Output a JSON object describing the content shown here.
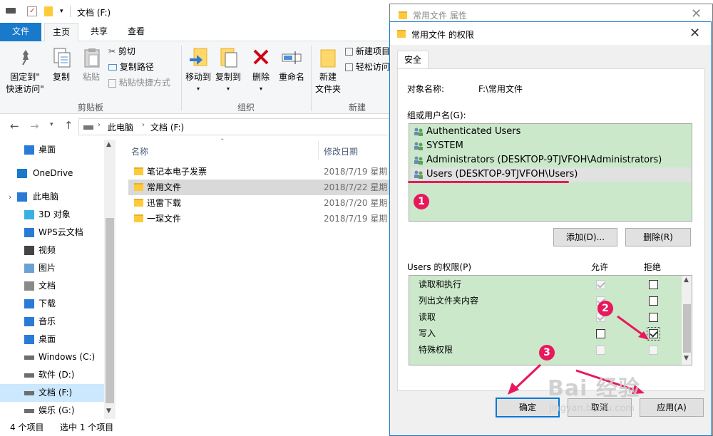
{
  "explorer": {
    "title": "文档 (F:)",
    "tabs": {
      "file": "文件",
      "home": "主页",
      "share": "共享",
      "view": "查看"
    },
    "ribbon": {
      "pin": "固定到\"\n快速访问\"",
      "pin_l1": "固定到\"",
      "pin_l2": "快速访问\"",
      "copy": "复制",
      "paste": "粘贴",
      "cut": "剪切",
      "copy_path": "复制路径",
      "paste_shortcut": "粘贴快捷方式",
      "group_clipboard": "剪贴板",
      "move_to": "移动到",
      "copy_to": "复制到",
      "delete": "删除",
      "rename": "重命名",
      "group_organize": "组织",
      "new_folder_l1": "新建",
      "new_folder_l2": "文件夹",
      "new_item": "新建项目",
      "easy_access": "轻松访问",
      "group_new": "新建"
    },
    "breadcrumb": {
      "pc": "此电脑",
      "drive": "文档 (F:)"
    },
    "nav": [
      {
        "label": "桌面",
        "icon": "desktop-icon"
      },
      {
        "label": "OneDrive",
        "icon": "onedrive-icon"
      },
      {
        "label": "此电脑",
        "icon": "pc-icon"
      },
      {
        "label": "3D 对象",
        "icon": "3d-objects-icon"
      },
      {
        "label": "WPS云文档",
        "icon": "wps-cloud-icon"
      },
      {
        "label": "视频",
        "icon": "video-icon"
      },
      {
        "label": "图片",
        "icon": "pictures-icon"
      },
      {
        "label": "文档",
        "icon": "documents-icon"
      },
      {
        "label": "下载",
        "icon": "download-icon"
      },
      {
        "label": "音乐",
        "icon": "music-icon"
      },
      {
        "label": "桌面",
        "icon": "desktop-icon"
      },
      {
        "label": "Windows (C:)",
        "icon": "drive-icon"
      },
      {
        "label": "软件 (D:)",
        "icon": "drive-icon"
      },
      {
        "label": "文档 (F:)",
        "icon": "drive-icon"
      },
      {
        "label": "娱乐 (G:)",
        "icon": "drive-icon"
      }
    ],
    "columns": {
      "name": "名称",
      "date": "修改日期"
    },
    "files": [
      {
        "name": "笔记本电子发票",
        "date": "2018/7/19 星期"
      },
      {
        "name": "常用文件",
        "date": "2018/7/22 星期"
      },
      {
        "name": "迅雷下载",
        "date": "2018/7/20 星期"
      },
      {
        "name": "一琛文件",
        "date": "2018/7/19 星期"
      }
    ],
    "status": {
      "count": "4 个项目",
      "selected": "选中 1 个项目"
    }
  },
  "properties_dialog": {
    "title": "常用文件 属性"
  },
  "perm_dialog": {
    "title": "常用文件 的权限",
    "tab_security": "安全",
    "object_label": "对象名称:",
    "object_value": "F:\\常用文件",
    "group_label": "组或用户名(G):",
    "users": [
      "Authenticated Users",
      "SYSTEM",
      "Administrators (DESKTOP-9TJVFOH\\Administrators)",
      "Users (DESKTOP-9TJVFOH\\Users)"
    ],
    "add_button": "添加(D)...",
    "remove_button": "删除(R)",
    "perm_label": "Users 的权限(P)",
    "allow_header": "允许",
    "deny_header": "拒绝",
    "permissions": [
      {
        "name": "读取和执行",
        "allow": true,
        "allow_disabled": true,
        "deny": false,
        "deny_disabled": false
      },
      {
        "name": "列出文件夹内容",
        "allow": true,
        "allow_disabled": true,
        "deny": false,
        "deny_disabled": false
      },
      {
        "name": "读取",
        "allow": true,
        "allow_disabled": true,
        "deny": false,
        "deny_disabled": false
      },
      {
        "name": "写入",
        "allow": false,
        "allow_disabled": false,
        "deny": true,
        "deny_disabled": false
      },
      {
        "name": "特殊权限",
        "allow": false,
        "allow_disabled": true,
        "deny": false,
        "deny_disabled": true
      }
    ],
    "ok_button": "确定",
    "cancel_button": "取消",
    "apply_button": "应用(A)"
  },
  "annotations": {
    "step1": "1",
    "step2": "2",
    "step3": "3",
    "accent": "#e8185c"
  },
  "watermark": {
    "logo": "Bai 经验",
    "url": "jingyan.baidu.com"
  },
  "colors": {
    "file_tab": "#1979ca",
    "list_bg": "#cbe8cb",
    "selection": "#cce8ff"
  }
}
